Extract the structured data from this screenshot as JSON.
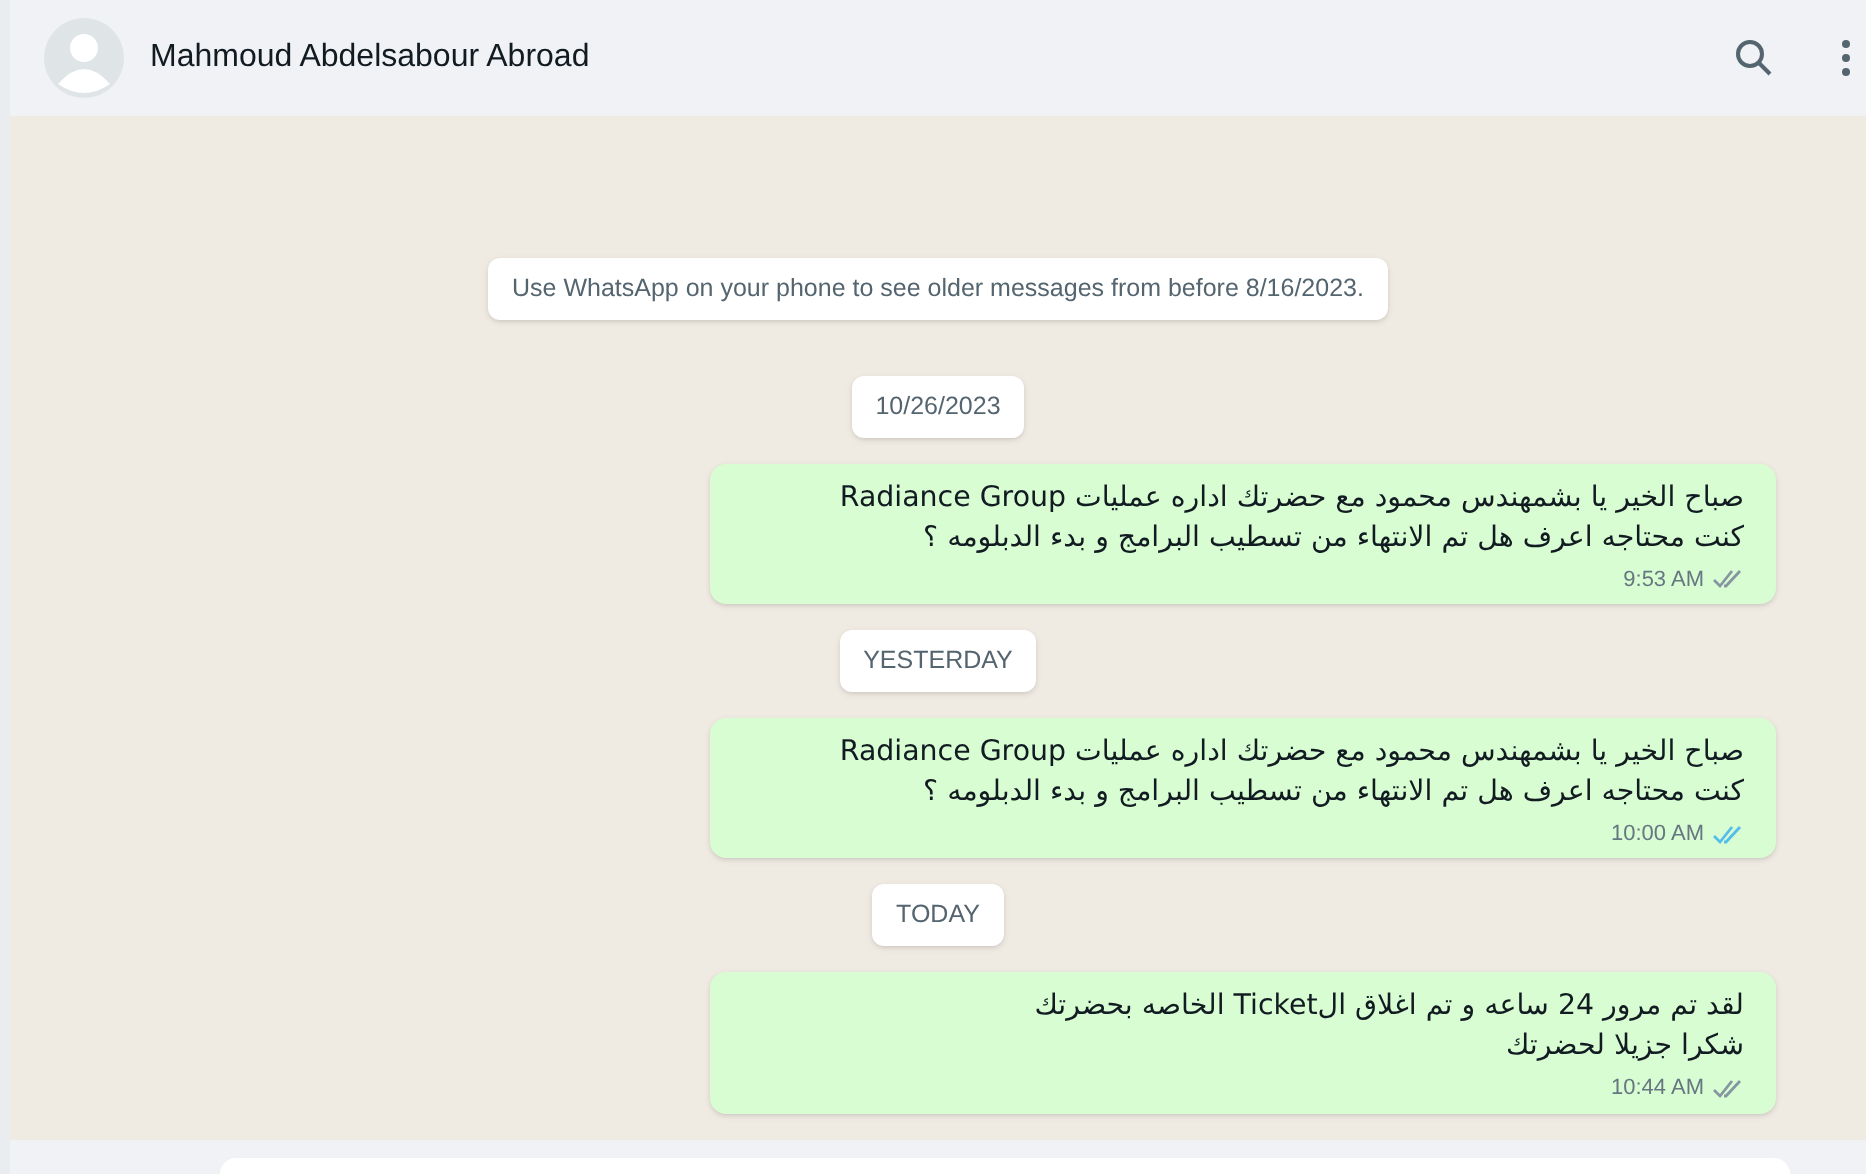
{
  "header": {
    "name": "Mahmoud Abdelsabour Abroad"
  },
  "items": [
    {
      "kind": "notice",
      "text": "Use WhatsApp on your phone to see older messages from before 8/16/2023."
    },
    {
      "kind": "date",
      "text": "10/26/2023"
    },
    {
      "kind": "message",
      "lines": [
        "صباح الخير يا بشمهندس محمود مع حضرتك اداره عمليات Radiance Group",
        "كنت محتاجه اعرف هل تم الانتهاء من تسطيب البرامج و بدء الدبلومه ؟"
      ],
      "time": "9:53 AM",
      "read": false
    },
    {
      "kind": "date",
      "text": "YESTERDAY"
    },
    {
      "kind": "message",
      "lines": [
        "صباح الخير يا بشمهندس محمود مع حضرتك اداره عمليات Radiance Group",
        "كنت محتاجه اعرف هل تم الانتهاء من تسطيب البرامج و بدء الدبلومه ؟"
      ],
      "time": "10:00 AM",
      "read": true
    },
    {
      "kind": "date",
      "text": "TODAY"
    },
    {
      "kind": "message",
      "lines": [
        "لقد تم مرور 24 ساعه و تم اغلاق الTicket الخاصه بحضرتك",
        "شكرا جزيلا لحضرتك"
      ],
      "time": "10:44 AM",
      "read": false
    }
  ]
}
